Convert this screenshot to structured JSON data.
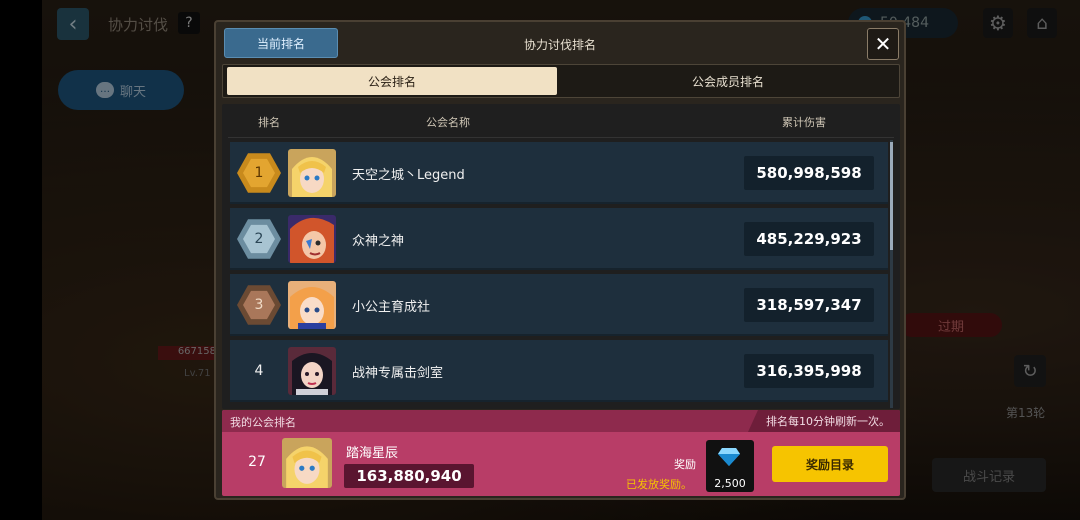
{
  "topbar": {
    "title": "协力讨伐",
    "help": "?",
    "back_icon": "chevron-left-icon"
  },
  "chat": {
    "label": "聊天"
  },
  "currency": {
    "value": "50,484"
  },
  "background": {
    "enemy_hp": "667158",
    "enemy_level": "Lv.71",
    "expired": "过期",
    "round": "第13轮",
    "battle_log": "战斗记录"
  },
  "modal": {
    "title": "协力讨伐排名",
    "current_tab": "当前排名",
    "close": "✕",
    "subtabs": {
      "guild": "公会排名",
      "member": "公会成员排名"
    },
    "headers": {
      "rank": "排名",
      "name": "公会名称",
      "damage": "累计伤害"
    },
    "rows": [
      {
        "rank": "1",
        "name": "天空之城丶Legend",
        "damage": "580,998,598",
        "badge": "gold"
      },
      {
        "rank": "2",
        "name": "众神之神",
        "damage": "485,229,923",
        "badge": "silver"
      },
      {
        "rank": "3",
        "name": "小公主育成社",
        "damage": "318,597,347",
        "badge": "bronze"
      },
      {
        "rank": "4",
        "name": "战神专属击剑室",
        "damage": "316,395,998",
        "badge": "none"
      }
    ],
    "mine": {
      "label": "我的公会排名",
      "note": "排名每10分钟刷新一次。",
      "rank": "27",
      "name": "踏海星辰",
      "damage": "163,880,940",
      "reward_label": "奖励",
      "reward_sent": "已发放奖励。",
      "reward_count": "2,500",
      "reward_button": "奖励目录"
    }
  }
}
